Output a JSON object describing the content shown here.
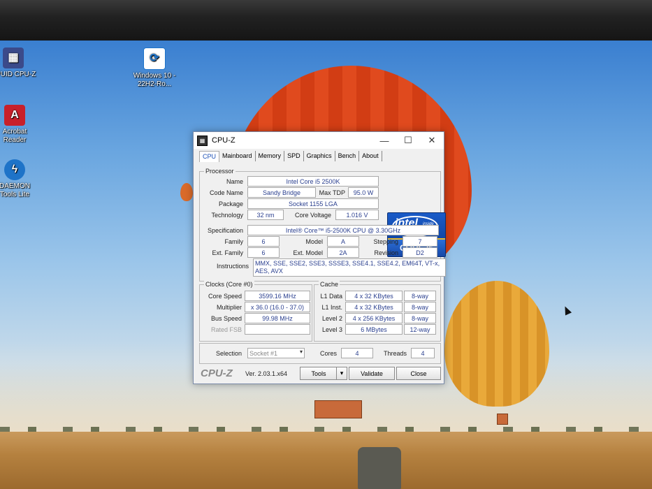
{
  "desktop_icons": [
    {
      "label": "CPUID CPU-Z",
      "icon": "cpuz-icon",
      "color": "#3b4a8a"
    },
    {
      "label": "Acrobat Reader",
      "icon": "acrobat-icon",
      "color": "#c8202a"
    },
    {
      "label": "DAEMON Tools Lite",
      "icon": "daemon-tools-icon",
      "color": "#1e73c8"
    },
    {
      "label": "Windows 10 - 22H2-Ro...",
      "icon": "windows-installer-icon",
      "color": "#1e73c8"
    }
  ],
  "window": {
    "title": "CPU-Z",
    "tabs": [
      "CPU",
      "Mainboard",
      "Memory",
      "SPD",
      "Graphics",
      "Bench",
      "About"
    ],
    "active_tab": "CPU",
    "processor": {
      "group_title": "Processor",
      "name_label": "Name",
      "name": "Intel Core i5 2500K",
      "codename_label": "Code Name",
      "codename": "Sandy Bridge",
      "tdp_label": "Max TDP",
      "tdp": "95.0 W",
      "package_label": "Package",
      "package": "Socket 1155 LGA",
      "tech_label": "Technology",
      "tech": "32 nm",
      "voltage_label": "Core Voltage",
      "voltage": "1.016 V",
      "spec_label": "Specification",
      "spec": "Intel® Core™ i5-2500K CPU @ 3.30GHz",
      "family_label": "Family",
      "family": "6",
      "model_label": "Model",
      "model": "A",
      "stepping_label": "Stepping",
      "stepping": "7",
      "extfamily_label": "Ext. Family",
      "extfamily": "6",
      "extmodel_label": "Ext. Model",
      "extmodel": "2A",
      "revision_label": "Revision",
      "revision": "D2",
      "instr_label": "Instructions",
      "instr": "MMX, SSE, SSE2, SSE3, SSSE3, SSE4.1, SSE4.2, EM64T, VT-x, AES, AVX",
      "logo_word": "intel",
      "logo_inside": "inside",
      "logo_core": "CORE i5"
    },
    "clocks": {
      "group_title": "Clocks (Core #0)",
      "speed_label": "Core Speed",
      "speed": "3599.16 MHz",
      "mult_label": "Multiplier",
      "mult": "x 36.0 (16.0 - 37.0)",
      "bus_label": "Bus Speed",
      "bus": "99.98 MHz",
      "fsb_label": "Rated FSB",
      "fsb": ""
    },
    "cache": {
      "group_title": "Cache",
      "rows": [
        {
          "label": "L1 Data",
          "size": "4 x 32 KBytes",
          "way": "8-way"
        },
        {
          "label": "L1 Inst.",
          "size": "4 x 32 KBytes",
          "way": "8-way"
        },
        {
          "label": "Level 2",
          "size": "4 x 256 KBytes",
          "way": "8-way"
        },
        {
          "label": "Level 3",
          "size": "6 MBytes",
          "way": "12-way"
        }
      ]
    },
    "selection": {
      "label": "Selection",
      "value": "Socket #1",
      "cores_label": "Cores",
      "cores": "4",
      "threads_label": "Threads",
      "threads": "4"
    },
    "footer": {
      "logo": "CPU-Z",
      "version": "Ver. 2.03.1.x64",
      "tools": "Tools",
      "validate": "Validate",
      "close": "Close"
    }
  }
}
